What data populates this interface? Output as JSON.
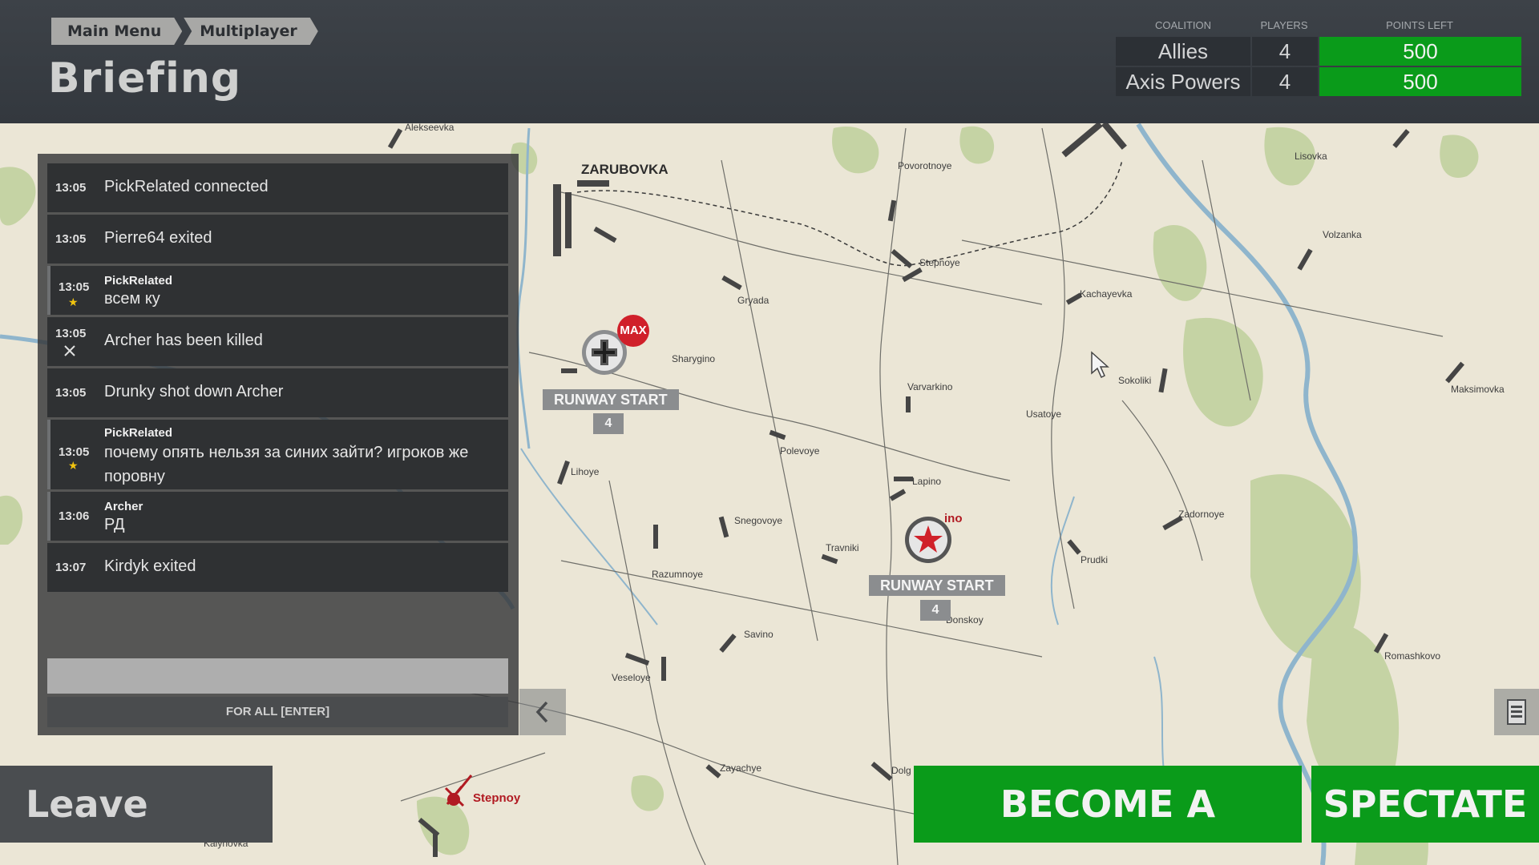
{
  "breadcrumb": {
    "main_menu": "Main Menu",
    "multiplayer": "Multiplayer"
  },
  "page_title": "Briefing",
  "coalition_table": {
    "headers": {
      "coalition": "COALITION",
      "players": "PLAYERS",
      "points_left": "POINTS LEFT"
    },
    "rows": [
      {
        "coalition": "Allies",
        "players": "4",
        "points": "500"
      },
      {
        "coalition": "Axis Powers",
        "players": "4",
        "points": "500"
      }
    ],
    "points_color": "#0a9b1a"
  },
  "chat": {
    "messages": [
      {
        "time": "13:05",
        "text": "PickRelated connected"
      },
      {
        "time": "13:05",
        "text": "Pierre64 exited"
      },
      {
        "time": "13:05",
        "author": "PickRelated",
        "text": "всем ку"
      },
      {
        "time": "13:05",
        "text": "Archer has been killed"
      },
      {
        "time": "13:05",
        "text": "Drunky shot down Archer"
      },
      {
        "time": "13:05",
        "author": "PickRelated",
        "text": "почему опять нельзя за синих зайти? игроков же поровну"
      },
      {
        "time": "13:06",
        "author": "Archer",
        "text": "РД"
      },
      {
        "time": "13:07",
        "text": "Kirdyk exited"
      }
    ],
    "input_value": "",
    "send_label": "FOR ALL [ENTER]"
  },
  "buttons": {
    "leave": "Leave Server",
    "gunner": "BECOME A GUNNER",
    "spectate": "SPECTATE"
  },
  "map": {
    "airfields": [
      {
        "label": "RUNWAY START",
        "count": "4",
        "badge": "MAX",
        "side": "axis",
        "icon": "balkenkreuz-icon"
      },
      {
        "label": "RUNWAY START",
        "count": "4",
        "side": "allies",
        "icon": "red-star-icon"
      }
    ],
    "towns": {
      "zarubovka": "ZARUBOVKA",
      "alekseevka": "Alekseevka",
      "povorotnoye": "Povorotnoye",
      "lisovka": "Lisovka",
      "volzanka": "Volzanka",
      "stepnoye": "Stepnoye",
      "gryada": "Gryada",
      "kachayevka": "Kachayevka",
      "sharygino": "Sharygino",
      "sokoliki": "Sokoliki",
      "maksimovka": "Maksimovka",
      "varvarkino": "Varvarkino",
      "usatoye": "Usatoye",
      "lihoye": "Lihoye",
      "polevoye": "Polevoye",
      "lapino": "Lapino",
      "zadornoye": "Zadornoye",
      "snegovoye": "Snegovoye",
      "travniki": "Travniki",
      "prudki": "Prudki",
      "razumnoye": "Razumnoye",
      "donskoy": "Donskoy",
      "savino": "Savino",
      "romashkovo": "Romashkovo",
      "veseloye": "Veseloye",
      "zayachye": "Zayachye",
      "dolg": "Dolg",
      "stepnoy": "Stepnoy",
      "kalynovka": "Kalynovka",
      "ino": "ino"
    }
  },
  "colors": {
    "accent": "#0a9b1a",
    "header": "#3a3f45",
    "axis_badge": "#d0202a",
    "allied_star": "#d0202a"
  }
}
